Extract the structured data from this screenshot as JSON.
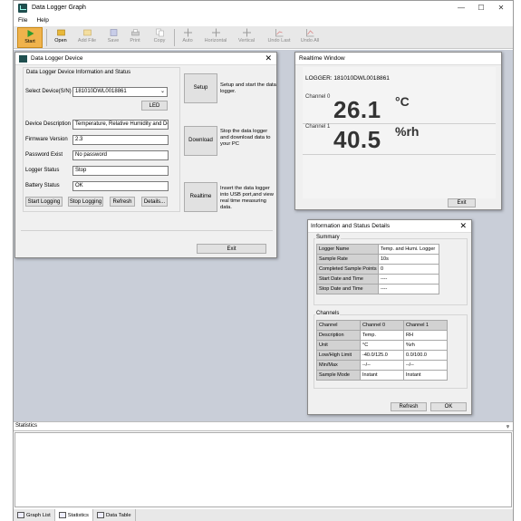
{
  "app": {
    "title": "Data Logger Graph",
    "win_min": "—",
    "win_max": "☐",
    "win_close": "✕"
  },
  "menu": [
    "File",
    "Help"
  ],
  "toolbar": {
    "start": "Start",
    "open": "Open",
    "add_file": "Add File",
    "save": "Save",
    "print": "Print",
    "copy": "Copy",
    "auto": "Auto",
    "horizontal": "Horizontal",
    "vertical": "Vertical",
    "undo_last": "Undo Last",
    "undo_all": "Undo All"
  },
  "device_dialog": {
    "title": "Data Logger Device",
    "close": "✕",
    "group_title": "Data Logger Device Information and Status",
    "select_label": "Select Device(S/N)",
    "select_value": "181010DWL0018861",
    "led_button": "LED",
    "desc_label": "Device Description",
    "desc_value": "Temperature, Relative Humidity and De",
    "firmware_label": "Firmware Version",
    "firmware_value": "2.3",
    "password_label": "Password Exist",
    "password_value": "No password",
    "status_label": "Logger Status",
    "status_value": "Stop",
    "battery_label": "Battery Status",
    "battery_value": "OK",
    "start_logging": "Start Logging",
    "stop_logging": "Stop Logging",
    "refresh": "Refresh",
    "details": "Details...",
    "setup_button": "Setup",
    "setup_desc": "Setup and start the data logger.",
    "download_button": "Download",
    "download_desc": "Stop the data logger and download data to your PC",
    "realtime_button": "Realtime",
    "realtime_desc": "Insert the data logger into USB port,and view real time measuring data.",
    "exit": "Exit"
  },
  "realtime_window": {
    "title": "Realtime Window",
    "logger": "LOGGER: 181010DWL0018861",
    "ch0_label": "Channel 0",
    "ch0_value": "26.1",
    "ch0_unit": "°C",
    "ch1_label": "Channel 1",
    "ch1_value": "40.5",
    "ch1_unit": "%rh",
    "exit": "Exit"
  },
  "info_dialog": {
    "title": "Information and Status Details",
    "close": "✕",
    "summary_title": "Summary",
    "summary": [
      {
        "k": "Logger Name",
        "v": "Temp. and Humi. Logger"
      },
      {
        "k": "Sample Rate",
        "v": "10s"
      },
      {
        "k": "Completed Sample Points",
        "v": "0"
      },
      {
        "k": "Start Date and Time",
        "v": "----"
      },
      {
        "k": "Stop Date and Time",
        "v": "----"
      }
    ],
    "channels_title": "Channels",
    "channels_header": [
      "Channel",
      "Channel 0",
      "Channel 1"
    ],
    "channels": [
      [
        "Description",
        "Temp.",
        "RH"
      ],
      [
        "Unit",
        "°C",
        "%rh"
      ],
      [
        "Low/High Limit",
        "-40.0/125.0",
        "0.0/100.0"
      ],
      [
        "Min/Max",
        "--/--",
        "--/--"
      ],
      [
        "Sample Mode",
        "Instant",
        "Instant"
      ]
    ],
    "refresh": "Refresh",
    "ok": "OK"
  },
  "statistics": {
    "title": "Statistics",
    "pin": "ᵩ"
  },
  "bottom_tabs": [
    "Graph List",
    "Statistics",
    "Data Table"
  ]
}
